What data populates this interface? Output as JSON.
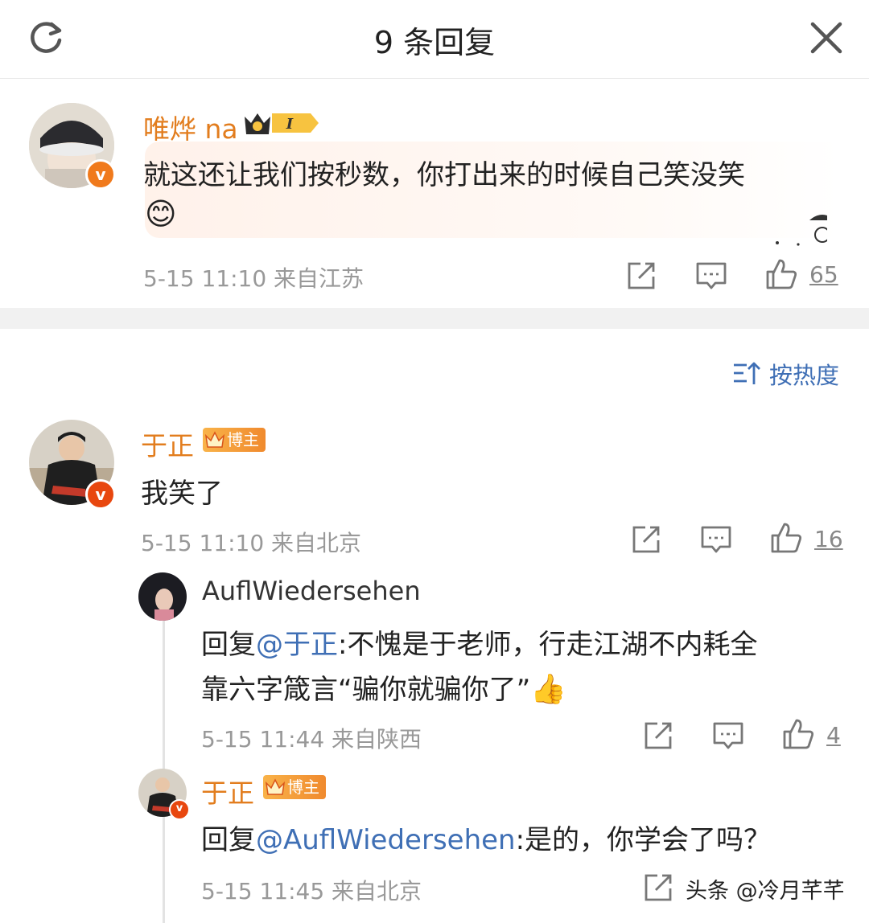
{
  "header": {
    "title": "9 条回复",
    "refresh_icon": "refresh-icon",
    "close_icon": "close-icon"
  },
  "main_comment": {
    "author": "唯烨 na",
    "text": "就这还让我们按秒数，你打出来的时候自己笑没笑",
    "emoji": "😊",
    "badge_level": "I",
    "time": "5-15 11:10",
    "location": "来自江苏",
    "likes": "65"
  },
  "sort": {
    "label": "按热度",
    "icon": "sort-icon"
  },
  "replies": [
    {
      "author": "于正",
      "tag": "博主",
      "text": "我笑了",
      "time": "5-15 11:10",
      "location": "来自北京",
      "likes": "16"
    },
    {
      "author": "AuflWiedersehen",
      "reply_prefix": "回复",
      "mention": "@于正",
      "text_line1": ":不愧是于老师，行走江湖不内耗全",
      "text_line2": "靠六字箴言“骗你就骗你了”",
      "emoji": "👍",
      "time": "5-15 11:44",
      "location": "来自陕西",
      "likes": "4"
    },
    {
      "author": "于正",
      "tag": "博主",
      "reply_prefix": "回复",
      "mention": "@AuflWiedersehen",
      "text": ":是的，你学会了吗？",
      "time": "5-15 11:45",
      "location": "来自北京"
    }
  ],
  "watermark": "头条 @冷月芊芊",
  "colors": {
    "name_orange": "#e27d1e",
    "mention_blue": "#3f6fb5",
    "meta_gray": "#999999"
  }
}
